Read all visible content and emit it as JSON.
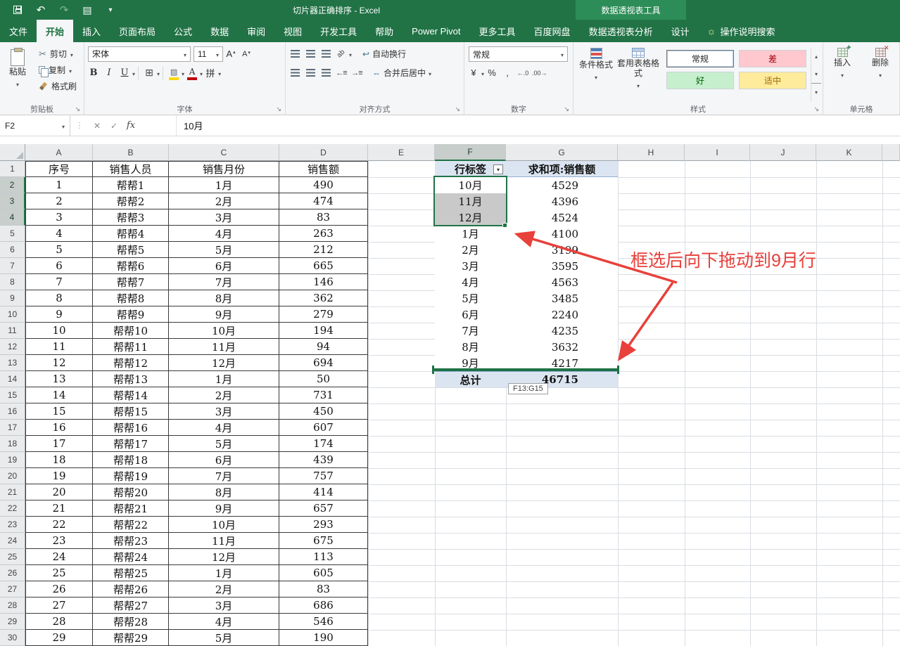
{
  "colors": {
    "excel_green": "#217346",
    "contextual_tab_green": "#2d8d58",
    "annotation_red": "#e8403a",
    "pivot_header_bg": "#dbe5f1",
    "selected_cell_gray": "#c9c9c9"
  },
  "title_bar": {
    "title": "切片器正确排序 - Excel",
    "contextual_tool": "数据透视表工具"
  },
  "tabs": [
    {
      "name": "file",
      "label": "文件"
    },
    {
      "name": "home",
      "label": "开始",
      "active": true
    },
    {
      "name": "insert",
      "label": "插入"
    },
    {
      "name": "page-layout",
      "label": "页面布局"
    },
    {
      "name": "formulas",
      "label": "公式"
    },
    {
      "name": "data",
      "label": "数据"
    },
    {
      "name": "review",
      "label": "审阅"
    },
    {
      "name": "view",
      "label": "视图"
    },
    {
      "name": "developer",
      "label": "开发工具"
    },
    {
      "name": "help",
      "label": "帮助"
    },
    {
      "name": "power-pivot",
      "label": "Power Pivot"
    },
    {
      "name": "more-tools",
      "label": "更多工具"
    },
    {
      "name": "baidu-netdisk",
      "label": "百度网盘"
    },
    {
      "name": "pivottable-analyze",
      "label": "数据透视表分析"
    },
    {
      "name": "design",
      "label": "设计"
    }
  ],
  "tell_me": {
    "label": "操作说明搜索"
  },
  "ribbon": {
    "clipboard": {
      "label": "剪贴板",
      "paste": "粘贴",
      "cut": "剪切",
      "copy": "复制",
      "format_painter": "格式刷"
    },
    "font": {
      "label": "字体",
      "font_name": "宋体",
      "font_size": "11",
      "bold": "B",
      "italic": "I",
      "underline": "U",
      "phonetic": "拼"
    },
    "alignment": {
      "label": "对齐方式",
      "wrap_text": "自动换行",
      "merge_center": "合并后居中"
    },
    "number": {
      "label": "数字",
      "format": "常规",
      "currency": "¥",
      "percent": "%",
      "comma": ","
    },
    "styles": {
      "label": "样式",
      "conditional_formatting": "条件格式",
      "format_as_table": "套用表格格式",
      "cell_styles": [
        {
          "label": "常规",
          "bg": "#ffffff",
          "fg": "#1f1f1f",
          "selected": true
        },
        {
          "label": "差",
          "bg": "#ffc7ce",
          "fg": "#9c0006"
        },
        {
          "label": "好",
          "bg": "#c6efce",
          "fg": "#006100"
        },
        {
          "label": "适中",
          "bg": "#ffeb9c",
          "fg": "#9c6500"
        }
      ]
    },
    "cells": {
      "label": "单元格",
      "insert": "插入",
      "delete": "删除"
    }
  },
  "formula_bar": {
    "name_box": "F2",
    "fx": "fx",
    "content": "10月"
  },
  "grid": {
    "column_headers": [
      "A",
      "B",
      "C",
      "D",
      "E",
      "F",
      "G",
      "H",
      "I",
      "J",
      "K"
    ],
    "row_count": 30,
    "selected_column": "F",
    "selected_rows": [
      2,
      3,
      4
    ]
  },
  "data_table": {
    "headers": [
      "序号",
      "销售人员",
      "销售月份",
      "销售额"
    ],
    "rows": [
      [
        1,
        "帮帮1",
        "1月",
        490
      ],
      [
        2,
        "帮帮2",
        "2月",
        474
      ],
      [
        3,
        "帮帮3",
        "3月",
        83
      ],
      [
        4,
        "帮帮4",
        "4月",
        263
      ],
      [
        5,
        "帮帮5",
        "5月",
        212
      ],
      [
        6,
        "帮帮6",
        "6月",
        665
      ],
      [
        7,
        "帮帮7",
        "7月",
        146
      ],
      [
        8,
        "帮帮8",
        "8月",
        362
      ],
      [
        9,
        "帮帮9",
        "9月",
        279
      ],
      [
        10,
        "帮帮10",
        "10月",
        194
      ],
      [
        11,
        "帮帮11",
        "11月",
        94
      ],
      [
        12,
        "帮帮12",
        "12月",
        694
      ],
      [
        13,
        "帮帮13",
        "1月",
        50
      ],
      [
        14,
        "帮帮14",
        "2月",
        731
      ],
      [
        15,
        "帮帮15",
        "3月",
        450
      ],
      [
        16,
        "帮帮16",
        "4月",
        607
      ],
      [
        17,
        "帮帮17",
        "5月",
        174
      ],
      [
        18,
        "帮帮18",
        "6月",
        439
      ],
      [
        19,
        "帮帮19",
        "7月",
        757
      ],
      [
        20,
        "帮帮20",
        "8月",
        414
      ],
      [
        21,
        "帮帮21",
        "9月",
        657
      ],
      [
        22,
        "帮帮22",
        "10月",
        293
      ],
      [
        23,
        "帮帮23",
        "11月",
        675
      ],
      [
        24,
        "帮帮24",
        "12月",
        113
      ],
      [
        25,
        "帮帮25",
        "1月",
        605
      ],
      [
        26,
        "帮帮26",
        "2月",
        83
      ],
      [
        27,
        "帮帮27",
        "3月",
        686
      ],
      [
        28,
        "帮帮28",
        "4月",
        546
      ],
      [
        29,
        "帮帮29",
        "5月",
        190
      ]
    ]
  },
  "pivot_table": {
    "headers": [
      "行标签",
      "求和项:销售额"
    ],
    "rows": [
      [
        "10月",
        4529
      ],
      [
        "11月",
        4396
      ],
      [
        "12月",
        4524
      ],
      [
        "1月",
        4100
      ],
      [
        "2月",
        3199
      ],
      [
        "3月",
        3595
      ],
      [
        "4月",
        4563
      ],
      [
        "5月",
        3485
      ],
      [
        "6月",
        2240
      ],
      [
        "7月",
        4235
      ],
      [
        "8月",
        3632
      ],
      [
        "9月",
        4217
      ]
    ],
    "total_label": "总计",
    "total_value": 46715,
    "active_item": "10月",
    "selected_items": [
      "11月",
      "12月"
    ]
  },
  "overlays": {
    "annotation": "框选后向下拖动到9月行",
    "drag_tooltip": "F13:G15"
  }
}
